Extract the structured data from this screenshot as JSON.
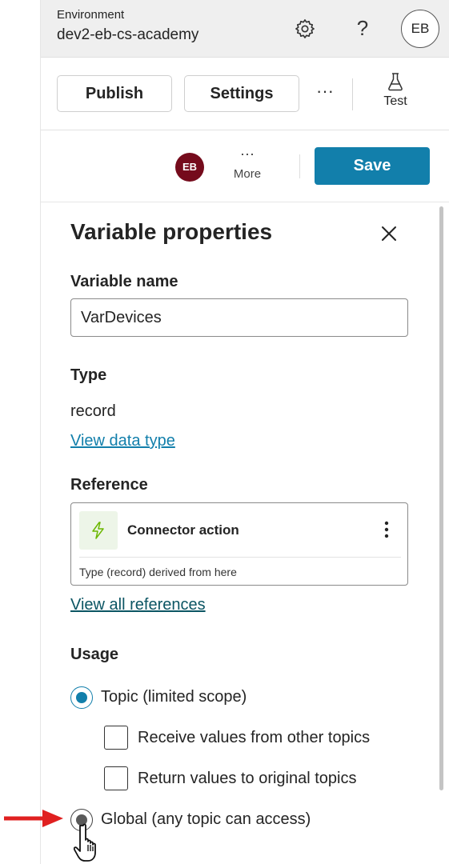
{
  "environment": {
    "label": "Environment",
    "name": "dev2-eb-cs-academy",
    "avatar_initials": "EB",
    "help_glyph": "?",
    "icons": [
      "gear-icon",
      "help-icon"
    ]
  },
  "toolbar": {
    "publish_label": "Publish",
    "settings_label": "Settings",
    "more_glyph": "···",
    "test_label": "Test",
    "test_icon": "flask-icon"
  },
  "actions": {
    "avatar_initials": "EB",
    "avatar_color": "#750b1c",
    "more_glyph": "···",
    "more_label": "More",
    "save_label": "Save",
    "save_color": "#127fab"
  },
  "panel": {
    "title": "Variable properties",
    "close_icon": "close-icon",
    "variable_name_label": "Variable name",
    "variable_name_value": "VarDevices",
    "type_label": "Type",
    "type_value": "record",
    "view_data_type_link": "View data type",
    "reference_label": "Reference",
    "reference": {
      "title": "Connector action",
      "icon": "lightning-icon",
      "note": "Type (record) derived from here"
    },
    "view_all_references_link": "View all references",
    "usage_label": "Usage",
    "usage_options": {
      "topic": "Topic (limited scope)",
      "receive": "Receive values from other topics",
      "return": "Return values to original topics",
      "global": "Global (any topic can access)"
    },
    "selected_usage": "Topic (limited scope)"
  },
  "annotation": {
    "arrow_color": "#e02020",
    "cursor": "hand-pointer-icon"
  }
}
